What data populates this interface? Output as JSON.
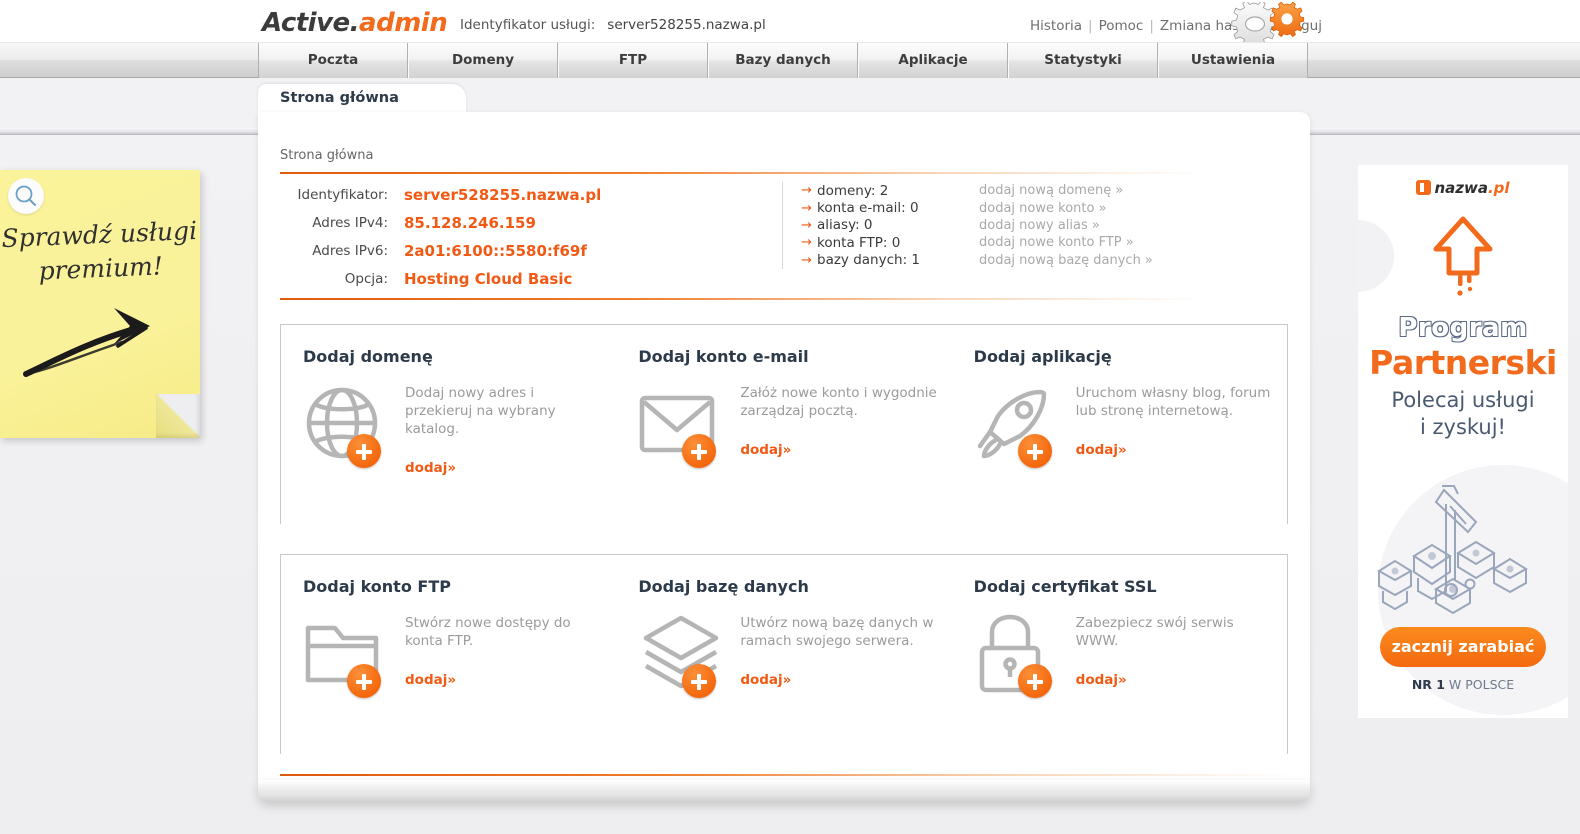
{
  "header": {
    "logo_primary": "Active.",
    "logo_accent": "admin",
    "service_label": "Identyfikator usługi:",
    "service_value": "server528255.nazwa.pl",
    "nav": [
      {
        "label": "Historia"
      },
      {
        "label": "Pomoc"
      },
      {
        "label": "Zmiana hasła"
      },
      {
        "label": "Wyloguj"
      }
    ],
    "nav_separator": "|",
    "gears_icon": "gears-icon"
  },
  "tabs": [
    {
      "label": "Poczta"
    },
    {
      "label": "Domeny"
    },
    {
      "label": "FTP"
    },
    {
      "label": "Bazy danych"
    },
    {
      "label": "Aplikacje"
    },
    {
      "label": "Statystyki"
    },
    {
      "label": "Ustawienia"
    }
  ],
  "panel": {
    "tab_label": "Strona główna",
    "breadcrumb": "Strona główna"
  },
  "info": {
    "rows": [
      {
        "label": "Identyfikator:",
        "value": "server528255.nazwa.pl"
      },
      {
        "label": "Adres IPv4:",
        "value": "85.128.246.159"
      },
      {
        "label": "Adres IPv6:",
        "value": "2a01:6100::5580:f69f"
      },
      {
        "label": "Opcja:",
        "value": "Hosting Cloud Basic"
      }
    ]
  },
  "stats": {
    "arrow": "→",
    "rows": [
      {
        "name": "domeny: 2",
        "link": "dodaj nową domenę »"
      },
      {
        "name": "konta e-mail: 0",
        "link": "dodaj nowe konto »"
      },
      {
        "name": "aliasy: 0",
        "link": "dodaj nowy alias »"
      },
      {
        "name": "konta FTP: 0",
        "link": "dodaj nowe konto FTP »"
      },
      {
        "name": "bazy danych: 1",
        "link": "dodaj nową bazę danych »"
      }
    ]
  },
  "cards_row1": [
    {
      "title": "Dodaj domenę",
      "desc": "Dodaj nowy adres i przekieruj na wybrany katalog.",
      "add": "dodaj»",
      "icon": "globe-icon"
    },
    {
      "title": "Dodaj konto e-mail",
      "desc": "Załóż nowe konto i wygodnie zarządzaj pocztą.",
      "add": "dodaj»",
      "icon": "envelope-icon"
    },
    {
      "title": "Dodaj aplikację",
      "desc": "Uruchom własny blog, forum lub stronę internetową.",
      "add": "dodaj»",
      "icon": "rocket-icon"
    }
  ],
  "cards_row2": [
    {
      "title": "Dodaj konto FTP",
      "desc": "Stwórz nowe dostępy do konta FTP.",
      "add": "dodaj»",
      "icon": "folder-icon"
    },
    {
      "title": "Dodaj bazę danych",
      "desc": "Utwórz nową bazę danych w ramach swojego serwera.",
      "add": "dodaj»",
      "icon": "database-layers-icon"
    },
    {
      "title": "Dodaj certyfikat SSL",
      "desc": "Zabezpiecz swój serwis WWW.",
      "add": "dodaj»",
      "icon": "padlock-icon"
    }
  ],
  "sticky": {
    "line1": "Sprawdź usługi",
    "line2": "premium!",
    "search_icon": "search-icon",
    "arrow_icon": "curved-arrow-icon"
  },
  "banner": {
    "logo_text": "nazwa",
    "logo_suffix": ".pl",
    "title_top": "Program",
    "title_bottom": "Partnerski",
    "subtitle_line1": "Polecaj usługi",
    "subtitle_line2": "i zyskuj!",
    "cta": "zacznij zarabiać",
    "footer_bold": "NR 1",
    "footer_rest": " W POLSCE",
    "arrow_icon": "up-arrow-icon",
    "illustration_icon": "coins-crane-icon"
  },
  "colors": {
    "accent_orange": "#f05a14",
    "banner_orange": "#f26a1b",
    "dark_blue": "#2c3a4a",
    "muted_grey": "#9b9b9b"
  }
}
